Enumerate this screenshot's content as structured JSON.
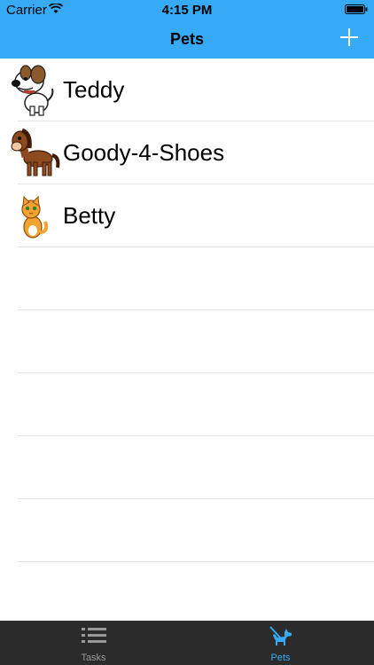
{
  "status_bar": {
    "carrier": "Carrier",
    "time": "4:15 PM"
  },
  "nav": {
    "title": "Pets",
    "add_icon": "plus-icon"
  },
  "pets": [
    {
      "name": "Teddy",
      "avatar": "dog"
    },
    {
      "name": "Goody-4-Shoes",
      "avatar": "horse"
    },
    {
      "name": "Betty",
      "avatar": "cat"
    }
  ],
  "tabbar": {
    "tabs": [
      {
        "label": "Tasks",
        "icon": "list-icon",
        "selected": false
      },
      {
        "label": "Pets",
        "icon": "dog-icon",
        "selected": true
      }
    ]
  },
  "colors": {
    "accent": "#36aaf5",
    "tabbar_bg": "#2b2b2b",
    "separator": "#e4e4e4"
  }
}
